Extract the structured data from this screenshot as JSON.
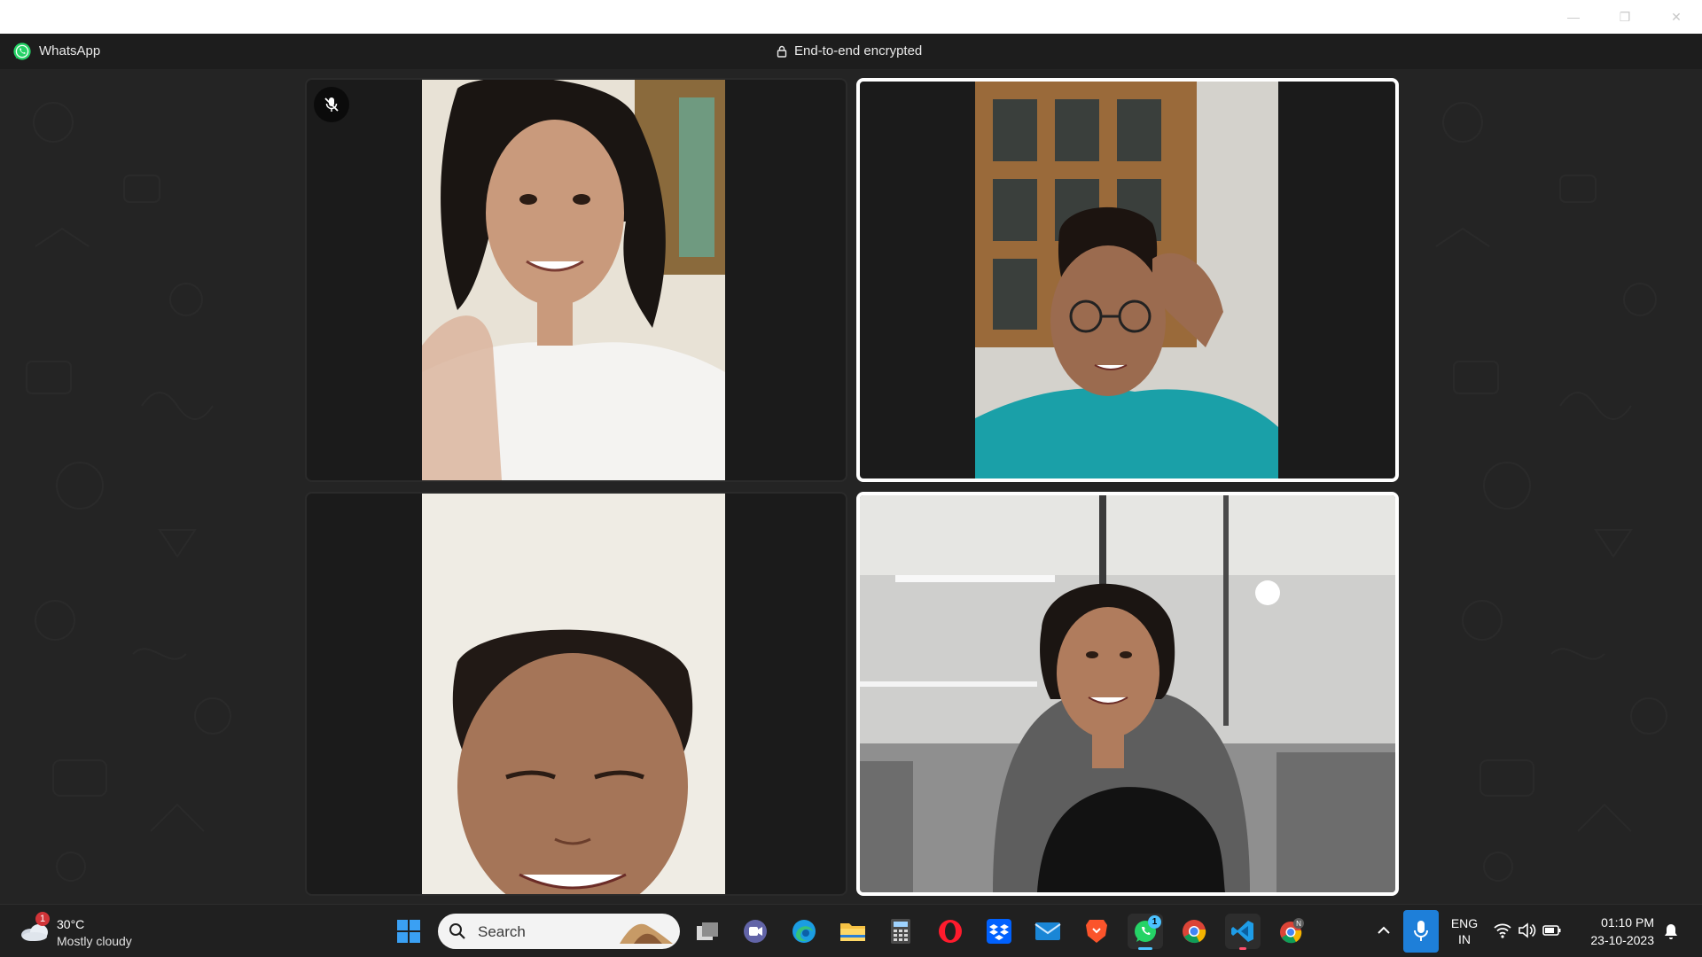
{
  "window": {
    "min_glyph": "—",
    "max_glyph": "❐",
    "close_glyph": "✕"
  },
  "app": {
    "name": "WhatsApp",
    "brand_color": "#25D366",
    "encryption_label": "End-to-end encrypted"
  },
  "call": {
    "participants": [
      {
        "tile": "participant-1",
        "muted": true,
        "active_speaker": false,
        "orientation": "portrait"
      },
      {
        "tile": "participant-2",
        "muted": false,
        "active_speaker": true,
        "orientation": "portrait"
      },
      {
        "tile": "participant-3",
        "muted": false,
        "active_speaker": false,
        "orientation": "portrait"
      },
      {
        "tile": "participant-4",
        "muted": false,
        "active_speaker": true,
        "orientation": "landscape"
      }
    ]
  },
  "taskbar": {
    "weather": {
      "temp": "30°C",
      "condition": "Mostly cloudy",
      "badge": "1"
    },
    "search": {
      "placeholder": "Search"
    },
    "pinned": [
      {
        "name": "start",
        "icon": "windows-start-icon"
      },
      {
        "name": "task-view",
        "icon": "task-view-icon"
      },
      {
        "name": "teams",
        "icon": "teams-chat-icon"
      },
      {
        "name": "edge",
        "icon": "edge-icon"
      },
      {
        "name": "file-explorer",
        "icon": "folder-icon"
      },
      {
        "name": "calculator",
        "icon": "calculator-icon"
      },
      {
        "name": "opera",
        "icon": "opera-icon"
      },
      {
        "name": "dropbox",
        "icon": "dropbox-icon"
      },
      {
        "name": "mail",
        "icon": "mail-icon"
      },
      {
        "name": "brave",
        "icon": "brave-icon"
      },
      {
        "name": "whatsapp",
        "icon": "whatsapp-icon",
        "badge": "1",
        "active": true
      },
      {
        "name": "chrome",
        "icon": "chrome-icon"
      },
      {
        "name": "vscode",
        "icon": "vscode-icon"
      },
      {
        "name": "chrome-profile",
        "icon": "chrome-profile-icon",
        "profile_letter": "N"
      }
    ],
    "tray": {
      "lang_top": "ENG",
      "lang_bottom": "IN",
      "time": "01:10 PM",
      "date": "23-10-2023"
    }
  }
}
